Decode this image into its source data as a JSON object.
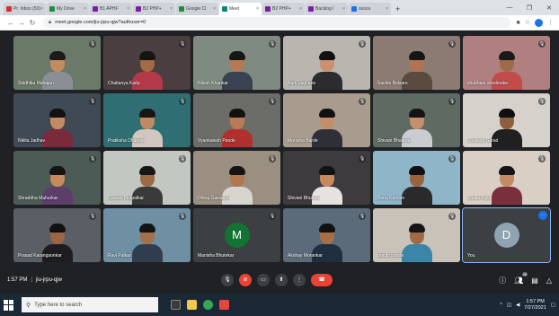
{
  "browser": {
    "tabs": [
      {
        "label": "Pr. Inbox (50)",
        "color": "#d93025",
        "active": false
      },
      {
        "label": "My Drive",
        "color": "#1e8e3e",
        "active": false
      },
      {
        "label": "B1 APHF",
        "color": "#7b1fa2",
        "active": false
      },
      {
        "label": "B2 PHP+",
        "color": "#7b1fa2",
        "active": false
      },
      {
        "label": "Google Cl",
        "color": "#1e8e3e",
        "active": false
      },
      {
        "label": "Meet",
        "color": "#00897b",
        "active": true
      },
      {
        "label": "B2 PHP+",
        "color": "#7b1fa2",
        "active": false
      },
      {
        "label": "Backlog I",
        "color": "#7b1fa2",
        "active": false
      },
      {
        "label": "ssoca",
        "color": "#1a73e8",
        "active": false
      }
    ],
    "new_tab": "+",
    "url": "meet.google.com/jiu-jrpu-qjw?authuser=0",
    "window_controls": [
      "—",
      "❐",
      "✕"
    ]
  },
  "participants": [
    {
      "name": "Siddhika Mahajan",
      "bg": "#6b7a68",
      "skin": "#c58b5e",
      "shirt": "#8a8f96",
      "hair": "#1b1b1b"
    },
    {
      "name": "Chaitanya Kadu",
      "bg": "#4b3e40",
      "skin": "#a36a45",
      "shirt": "#b23a48",
      "hair": "#141414"
    },
    {
      "name": "Nilesh Khankar",
      "bg": "#7f8a80",
      "skin": "#b57a52",
      "shirt": "#394250",
      "hair": "#161616"
    },
    {
      "name": "Aarti Laghane",
      "bg": "#b9b6b0",
      "skin": "#c99170",
      "shirt": "#2c2c2e",
      "hair": "#111111"
    },
    {
      "name": "Sachin Belsare",
      "bg": "#8c7b72",
      "skin": "#b27450",
      "shirt": "#5b4b3f",
      "hair": "#151515"
    },
    {
      "name": "shubham shedmake",
      "bg": "#b07f7f",
      "skin": "#9d6b4c",
      "shirt": "#c24b4b",
      "hair": "#1a1a1a"
    },
    {
      "name": "Nikita Jadhav",
      "bg": "#3f4a55",
      "skin": "#c48a63",
      "shirt": "#7a2a3a",
      "hair": "#121212"
    },
    {
      "name": "Pratiksha Dhakate",
      "bg": "#2f6f73",
      "skin": "#c08a62",
      "shirt": "#d1c7c0",
      "hair": "#161616"
    },
    {
      "name": "Vyankatesh Pande",
      "bg": "#6c6c68",
      "skin": "#b87c52",
      "shirt": "#b22f2f",
      "hair": "#121212"
    },
    {
      "name": "Manisha Barde",
      "bg": "#a89c8e",
      "skin": "#c48e6a",
      "shirt": "#2f2f3a",
      "hair": "#111111"
    },
    {
      "name": "Shivani Bhalerao",
      "bg": "#5e6a62",
      "skin": "#c58f6a",
      "shirt": "#c9ccd1",
      "hair": "#151515"
    },
    {
      "name": "Shailesh Garad",
      "bg": "#d6d2cb",
      "skin": "#8f5e3f",
      "shirt": "#202020",
      "hair": "#0f0f0f"
    },
    {
      "name": "Shraddha Mahurkar",
      "bg": "#4d5b56",
      "skin": "#c58b5e",
      "shirt": "#5d3d6a",
      "hair": "#141414"
    },
    {
      "name": "Gaurav Pimpalkar",
      "bg": "#c3c7c2",
      "skin": "#9b6a47",
      "shirt": "#3a3a3a",
      "hair": "#161616"
    },
    {
      "name": "Dhiraj Gawande",
      "bg": "#9a8f80",
      "skin": "#b07850",
      "shirt": "#d8d5cf",
      "hair": "#141414"
    },
    {
      "name": "Shivani Bhusare",
      "bg": "#3e3b3e",
      "skin": "#c58b5e",
      "shirt": "#e6e2df",
      "hair": "#121212"
    },
    {
      "name": "Sonu Kamble",
      "bg": "#8fb5c9",
      "skin": "#9b6240",
      "shirt": "#2a2a2a",
      "hair": "#111111"
    },
    {
      "name": "Shaila Ingle",
      "bg": "#d9cfc4",
      "skin": "#c48a66",
      "shirt": "#7a2f3c",
      "hair": "#141414"
    },
    {
      "name": "Prasad Karangaonkar",
      "bg": "#5a5f66",
      "skin": "#9a6645",
      "shirt": "#1d1d1f",
      "hair": "#101010"
    },
    {
      "name": "Ravi Palkar",
      "bg": "#6f8fa3",
      "skin": "#a36f4c",
      "shirt": "#2f3d4f",
      "hair": "#141414"
    },
    {
      "name": "Manisha Bhutekar",
      "bg": "#3c4043",
      "avatar": "M",
      "avatar_color": "#137333"
    },
    {
      "name": "Akshay Morankar",
      "bg": "#5b6b7a",
      "skin": "#a76e48",
      "shirt": "#1f2f3f",
      "hair": "#111111"
    },
    {
      "name": "pradip pande",
      "bg": "#c9c2b8",
      "skin": "#a16a47",
      "shirt": "#3b86a8",
      "hair": "#151515"
    },
    {
      "name": "You",
      "bg": "#3c4043",
      "avatar": "D",
      "avatar_color": "#8fa3b0",
      "highlight": true,
      "more_options": "⋯"
    }
  ],
  "meeting": {
    "time": "1:57 PM",
    "code": "jiu-jrpu-qjw"
  },
  "controls": {
    "center": [
      "mic-icon",
      "camera-off-icon",
      "captions-icon",
      "present-icon",
      "more-icon",
      "hangup-icon"
    ],
    "right": [
      "info-icon",
      "people-icon",
      "chat-icon",
      "activities-icon"
    ],
    "people_count": "26"
  },
  "taskbar": {
    "search_placeholder": "Type here to search",
    "time": "1:57 PM",
    "date": "7/27/2021"
  }
}
